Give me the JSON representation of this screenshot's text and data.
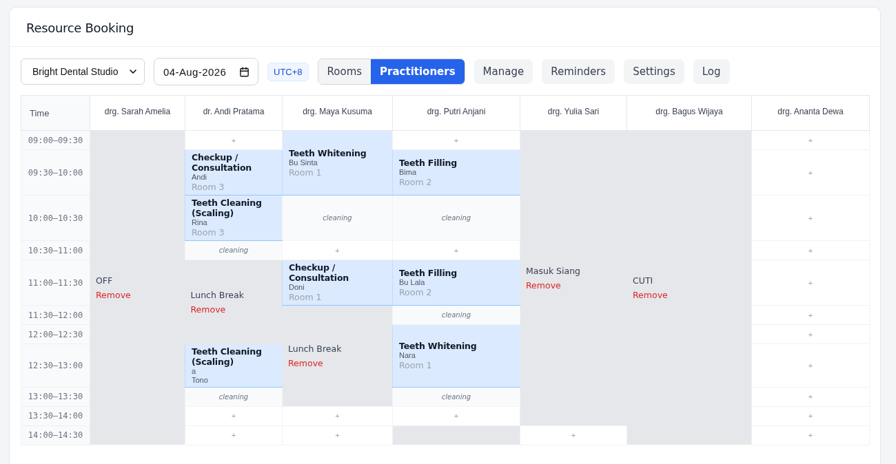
{
  "title": "Resource Booking",
  "toolbar": {
    "clinic": "Bright Dental Studio",
    "date": "04-Aug-2026",
    "timezone": "UTC+8",
    "views": [
      {
        "label": "Rooms",
        "selected": false
      },
      {
        "label": "Practitioners",
        "selected": true
      }
    ],
    "buttons": [
      "Manage",
      "Reminders",
      "Settings",
      "Log"
    ]
  },
  "time_heading": "Time",
  "columns": [
    "drg. Sarah Amelia",
    "dr. Andi Pratama",
    "drg. Maya Kusuma",
    "drg. Putri Anjani",
    "drg. Yulia Sari",
    "drg. Bagus Wijaya",
    "drg. Ananta Dewa"
  ],
  "rows": [
    {
      "time": "09:00–09:30",
      "cells": [
        {
          "kind": "blocked",
          "label": "OFF",
          "action": "Remove"
        },
        {
          "kind": "free",
          "label": "+"
        },
        {
          "kind": "booking",
          "title": "Teeth Whitening",
          "details": [
            "Bu Sinta"
          ],
          "room": "Room 1"
        },
        {
          "kind": "free",
          "label": "+"
        },
        {
          "kind": "blocked",
          "label": "Masuk Siang",
          "action": "Remove"
        },
        {
          "kind": "blocked",
          "label": "CUTI",
          "action": "Remove"
        },
        {
          "kind": "free",
          "label": "+"
        }
      ]
    },
    {
      "time": "09:30–10:00",
      "cells": [
        {
          "kind": "continued"
        },
        {
          "kind": "booking",
          "title": "Checkup / Consultation",
          "details": [
            "Andi"
          ],
          "room": "Room 3"
        },
        {
          "kind": "continued"
        },
        {
          "kind": "booking",
          "title": "Teeth Filling",
          "details": [
            "Bima"
          ],
          "room": "Room 2"
        },
        {
          "kind": "continued"
        },
        {
          "kind": "continued"
        },
        {
          "kind": "free",
          "label": "+"
        }
      ]
    },
    {
      "time": "10:00–10:30",
      "cells": [
        {
          "kind": "continued"
        },
        {
          "kind": "booking",
          "title": "Teeth Cleaning (Scaling)",
          "details": [
            "Rina"
          ],
          "room": "Room 3"
        },
        {
          "kind": "cleaning",
          "label": "cleaning"
        },
        {
          "kind": "cleaning",
          "label": "cleaning"
        },
        {
          "kind": "continued"
        },
        {
          "kind": "continued"
        },
        {
          "kind": "free",
          "label": "+"
        }
      ]
    },
    {
      "time": "10:30–11:00",
      "cells": [
        {
          "kind": "continued"
        },
        {
          "kind": "cleaning",
          "label": "cleaning"
        },
        {
          "kind": "free",
          "label": "+"
        },
        {
          "kind": "free",
          "label": "+"
        },
        {
          "kind": "continued"
        },
        {
          "kind": "continued"
        },
        {
          "kind": "free",
          "label": "+"
        }
      ]
    },
    {
      "time": "11:00–11:30",
      "cells": [
        {
          "kind": "continued"
        },
        {
          "kind": "blocked",
          "label": "Lunch Break",
          "action": "Remove"
        },
        {
          "kind": "booking",
          "title": "Checkup / Consultation",
          "details": [
            "Doni"
          ],
          "room": "Room 1"
        },
        {
          "kind": "booking",
          "title": "Teeth Filling",
          "details": [
            "Bu Lala"
          ],
          "room": "Room 2"
        },
        {
          "kind": "continued"
        },
        {
          "kind": "continued"
        },
        {
          "kind": "free",
          "label": "+"
        }
      ]
    },
    {
      "time": "11:30–12:00",
      "cells": [
        {
          "kind": "continued"
        },
        {
          "kind": "continued"
        },
        {
          "kind": "blocked",
          "label": "Lunch Break",
          "action": "Remove"
        },
        {
          "kind": "cleaning",
          "label": "cleaning"
        },
        {
          "kind": "continued"
        },
        {
          "kind": "continued"
        },
        {
          "kind": "free",
          "label": "+"
        }
      ]
    },
    {
      "time": "12:00–12:30",
      "cells": [
        {
          "kind": "continued"
        },
        {
          "kind": "continued"
        },
        {
          "kind": "continued"
        },
        {
          "kind": "booking",
          "title": "Teeth Whitening",
          "details": [
            "Nara"
          ],
          "room": "Room 1"
        },
        {
          "kind": "continued"
        },
        {
          "kind": "continued"
        },
        {
          "kind": "free",
          "label": "+"
        }
      ]
    },
    {
      "time": "12:30–13:00",
      "cells": [
        {
          "kind": "continued"
        },
        {
          "kind": "booking",
          "title": "Teeth Cleaning (Scaling)",
          "details": [
            "a",
            "Tono"
          ]
        },
        {
          "kind": "continued"
        },
        {
          "kind": "continued"
        },
        {
          "kind": "continued"
        },
        {
          "kind": "continued"
        },
        {
          "kind": "free",
          "label": "+"
        }
      ]
    },
    {
      "time": "13:00–13:30",
      "cells": [
        {
          "kind": "continued"
        },
        {
          "kind": "cleaning",
          "label": "cleaning"
        },
        {
          "kind": "continued"
        },
        {
          "kind": "cleaning",
          "label": "cleaning"
        },
        {
          "kind": "continued"
        },
        {
          "kind": "continued"
        },
        {
          "kind": "free",
          "label": "+"
        }
      ]
    },
    {
      "time": "13:30–14:00",
      "cells": [
        {
          "kind": "continued"
        },
        {
          "kind": "free",
          "label": "+"
        },
        {
          "kind": "free",
          "label": "+"
        },
        {
          "kind": "free",
          "label": "+"
        },
        {
          "kind": "continued"
        },
        {
          "kind": "continued"
        },
        {
          "kind": "free",
          "label": "+"
        }
      ]
    },
    {
      "time": "14:00–14:30",
      "cells": [
        {
          "kind": "continued"
        },
        {
          "kind": "free",
          "label": "+"
        },
        {
          "kind": "free",
          "label": "+"
        },
        {
          "kind": "blocked"
        },
        {
          "kind": "free",
          "label": "+"
        },
        {
          "kind": "continued"
        },
        {
          "kind": "free",
          "label": "+"
        }
      ]
    }
  ]
}
